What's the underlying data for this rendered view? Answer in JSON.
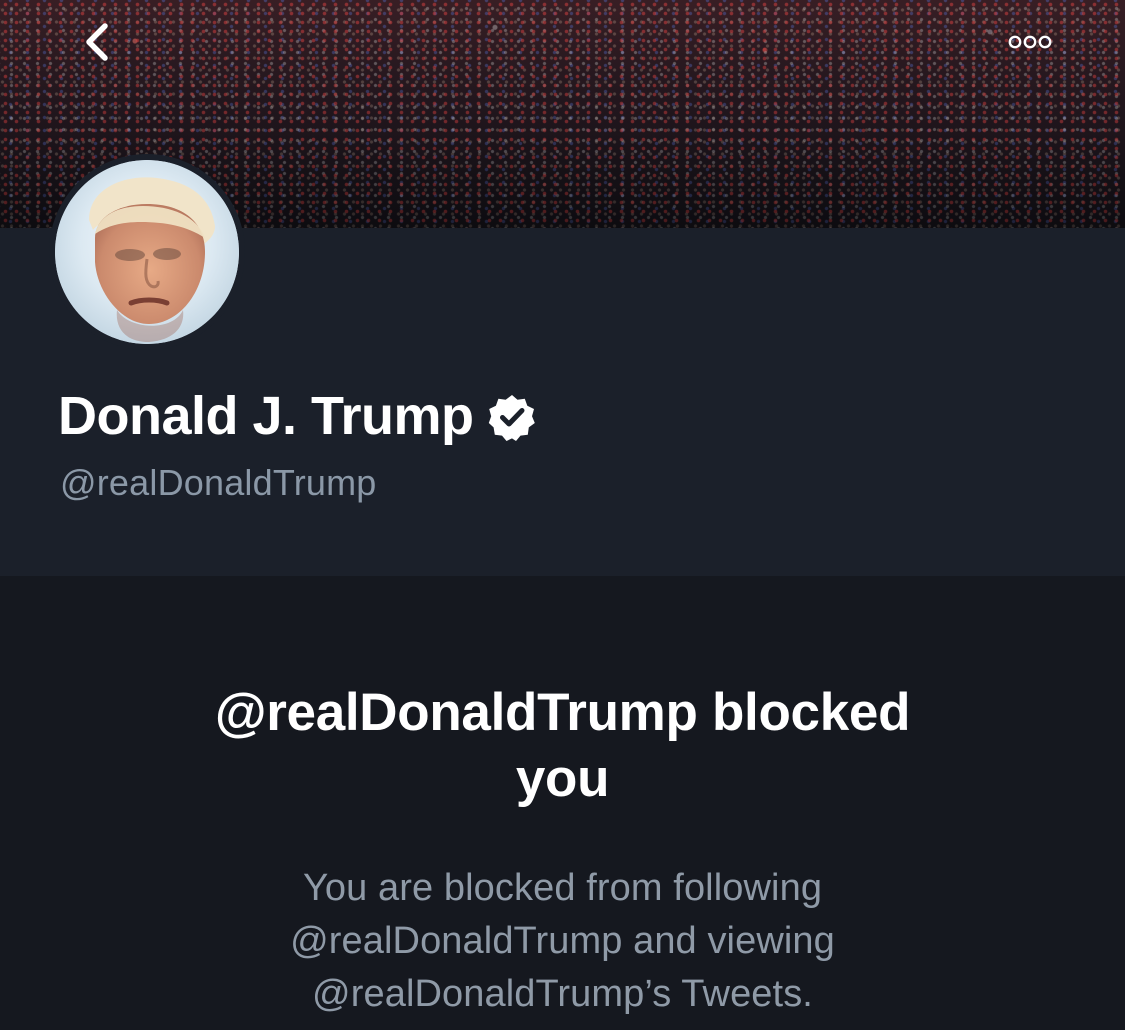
{
  "header": {
    "back_icon": "chevron-left-icon",
    "more_icon": "more-horizontal-icon"
  },
  "profile": {
    "display_name": "Donald J. Trump",
    "handle": "@realDonaldTrump",
    "verified_icon": "verified-badge-icon"
  },
  "blocked_notice": {
    "title_line1": "@realDonaldTrump blocked",
    "title_line2": "you",
    "message_line1": "You are blocked from following",
    "message_line2": "@realDonaldTrump and viewing",
    "message_line3": "@realDonaldTrump’s Tweets."
  },
  "colors": {
    "background": "#15181f",
    "header_panel": "#1b202a",
    "secondary_text": "#8b98a7",
    "primary_text": "#ffffff"
  }
}
